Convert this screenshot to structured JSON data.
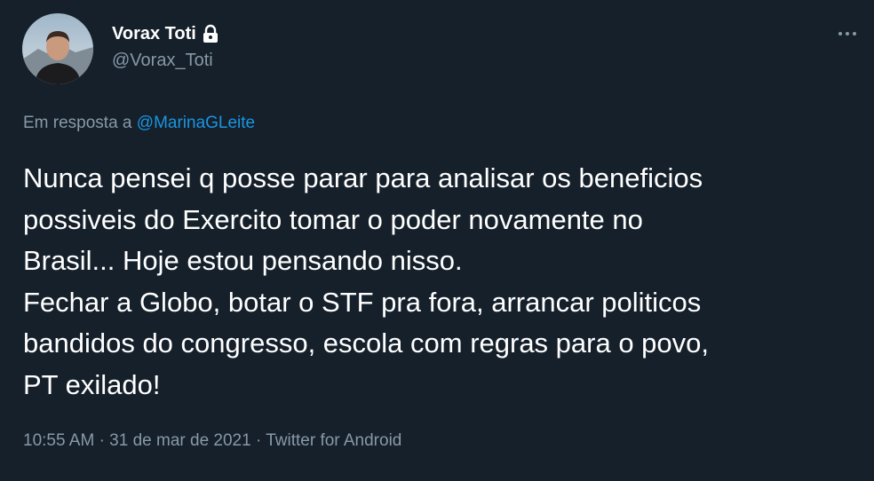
{
  "tweet": {
    "author": {
      "display_name": "Vorax Toti",
      "handle": "@Vorax_Toti",
      "protected_icon": "lock-icon",
      "avatar_icon": "avatar"
    },
    "more_icon": "more-horizontal-icon",
    "reply": {
      "prefix": "Em resposta a",
      "mention": "@MarinaGLeite"
    },
    "text_lines": [
      "Nunca pensei q posse parar para analisar os beneficios",
      "possiveis do Exercito tomar o poder novamente no",
      "Brasil... Hoje estou pensando nisso.",
      "Fechar a Globo, botar o STF pra fora, arrancar politicos",
      "bandidos do congresso, escola com regras para o povo,",
      "PT exilado!"
    ],
    "meta": {
      "time": "10:55 AM",
      "date": "31 de mar de 2021",
      "source": "Twitter for Android",
      "separator": "·"
    }
  },
  "colors": {
    "background": "#15202b",
    "primary_text": "#ffffff",
    "secondary_text": "#8899a6",
    "link": "#1b95e0"
  }
}
